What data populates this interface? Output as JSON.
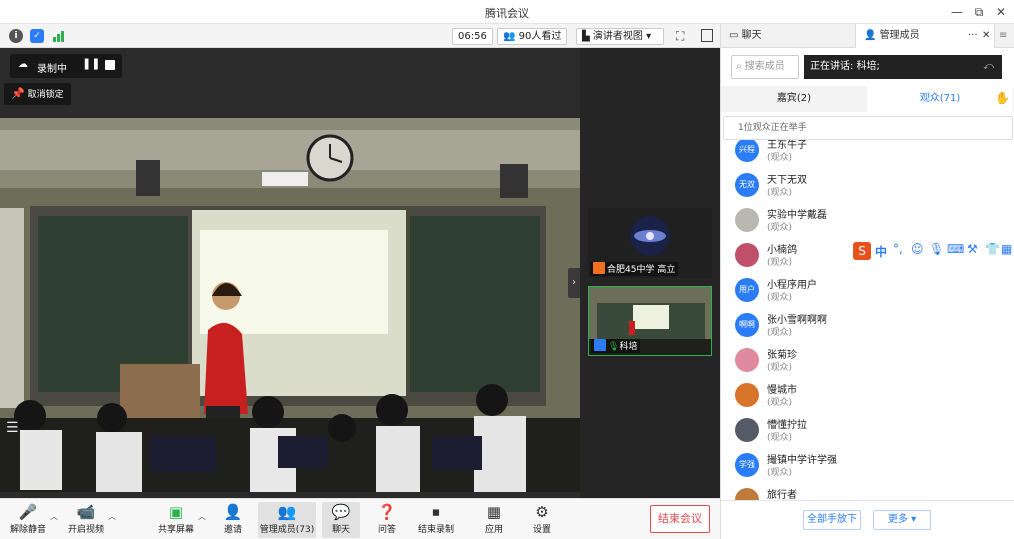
{
  "window": {
    "title": "腾讯会议",
    "minimize": "—",
    "restore": "⧉",
    "close": "✕"
  },
  "status": {
    "timer": "06:56",
    "viewers": "90人看过",
    "view_mode": "演讲者视图"
  },
  "stage": {
    "rec_label": "录制中",
    "unlock_label": "取消锁定",
    "thumbs": [
      {
        "label": "合肥45中学 高立"
      },
      {
        "label": "科培"
      }
    ]
  },
  "toolbar": {
    "unmute": "解除静音",
    "video": "开启视频",
    "share": "共享屏幕",
    "invite": "邀请",
    "members": "管理成员(73)",
    "chat": "聊天",
    "qa": "问答",
    "end_rec": "结束录制",
    "apps": "应用",
    "settings": "设置",
    "end_meeting": "结束会议"
  },
  "panel": {
    "tab_chat": "聊天",
    "tab_members": "管理成员",
    "search_placeholder": "搜索成员",
    "speaking": "正在讲话: 科培;",
    "tab_guests": "嘉宾(2)",
    "tab_audience": "观众(71)",
    "hand_note": "1位观众正在举手",
    "members": [
      {
        "name": "王东牛子",
        "role": "(观众)",
        "avatar": "兴程",
        "color": "#2a7cf7"
      },
      {
        "name": "天下无双",
        "role": "(观众)",
        "avatar": "无双",
        "color": "#2a7cf7"
      },
      {
        "name": "实验中学戴磊",
        "role": "(观众)",
        "avatar": "",
        "color": "#b8b8b0"
      },
      {
        "name": "小楠鸽",
        "role": "(观众)",
        "avatar": "",
        "color": "#c0506a"
      },
      {
        "name": "小程序用户",
        "role": "(观众)",
        "avatar": "用户",
        "color": "#2a7cf7"
      },
      {
        "name": "张小雪啊啊啊",
        "role": "(观众)",
        "avatar": "啊啊",
        "color": "#2a7cf7"
      },
      {
        "name": "张菊珍",
        "role": "(观众)",
        "avatar": "",
        "color": "#e08aa0"
      },
      {
        "name": "慢城市",
        "role": "(观众)",
        "avatar": "",
        "color": "#d8742a"
      },
      {
        "name": "懵懂拧拉",
        "role": "(观众)",
        "avatar": "",
        "color": "#555b66"
      },
      {
        "name": "撮镇中学许学强",
        "role": "(观众)",
        "avatar": "学强",
        "color": "#2a7cf7"
      },
      {
        "name": "旅行者",
        "role": "(观众)",
        "avatar": "",
        "color": "#c07a3a"
      }
    ],
    "ime_label": "中",
    "all_hands_down": "全部手放下",
    "more": "更多 ▾"
  }
}
